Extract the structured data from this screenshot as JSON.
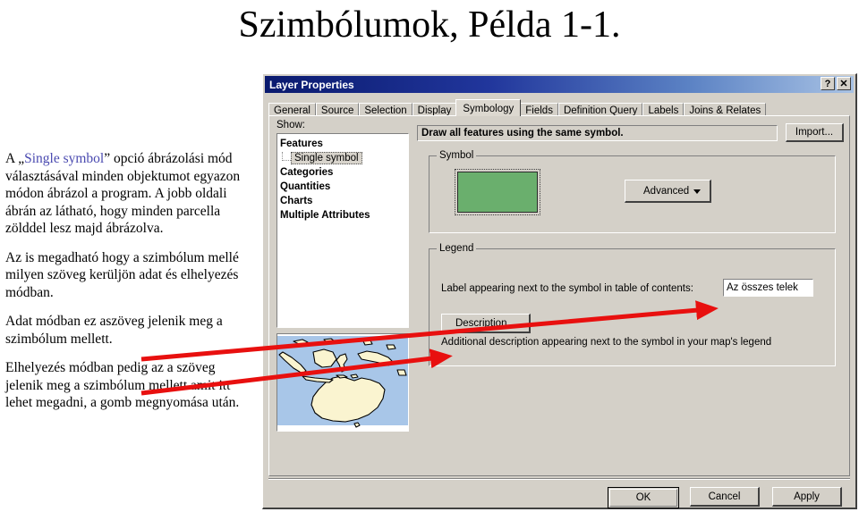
{
  "slide": {
    "title": "Szimbólumok, Példa 1-1.",
    "paragraphs": [
      {
        "before": "A „",
        "keyword": "Single symbol",
        "after": "” opció ábrázolási mód választásával minden objektumot egyazon módon ábrázol a program. A jobb oldali ábrán az látható, hogy minden parcella zölddel lesz majd ábrázolva."
      },
      {
        "text": "Az is megadható hogy a szimbólum mellé milyen szöveg kerüljön adat és elhelyezés módban."
      },
      {
        "text": "Adat módban ez aszöveg jelenik meg a szimbólum mellett."
      },
      {
        "text": "Elhelyezés módban pedig az a szöveg jelenik meg a szimbólum mellett amit itt lehet megadni, a gomb megnyomása után."
      }
    ],
    "annotation_arrow_color": "#e8100f"
  },
  "dialog": {
    "title": "Layer Properties",
    "help_button": "?",
    "close_button": "✕",
    "tabs": [
      {
        "label": "General",
        "active": false
      },
      {
        "label": "Source",
        "active": false
      },
      {
        "label": "Selection",
        "active": false
      },
      {
        "label": "Display",
        "active": false
      },
      {
        "label": "Symbology",
        "active": true
      },
      {
        "label": "Fields",
        "active": false
      },
      {
        "label": "Definition Query",
        "active": false
      },
      {
        "label": "Labels",
        "active": false
      },
      {
        "label": "Joins & Relates",
        "active": false
      }
    ],
    "symbology": {
      "show_label": "Show:",
      "tree": [
        {
          "label": "Features",
          "type": "node",
          "selected": false
        },
        {
          "label": "Single symbol",
          "type": "child",
          "selected": true
        },
        {
          "label": "Categories",
          "type": "node",
          "selected": false
        },
        {
          "label": "Quantities",
          "type": "node",
          "selected": false
        },
        {
          "label": "Charts",
          "type": "node",
          "selected": false
        },
        {
          "label": "Multiple Attributes",
          "type": "node",
          "selected": false
        }
      ],
      "description_banner": "Draw all features using the same symbol.",
      "import_button": "Import...",
      "symbol_group": {
        "title": "Symbol",
        "swatch_color": "#6aaf6d",
        "advanced_button": "Advanced"
      },
      "legend_group": {
        "title": "Legend",
        "label_text": "Label appearing next to the symbol in table of contents:",
        "label_value": "Az összes telek",
        "description_button": "Description...",
        "description_note": "Additional description appearing next to the symbol in your map's legend"
      },
      "map_preview": {
        "water_color": "#a8c6e8",
        "land_color": "#faf4d0"
      }
    },
    "buttons": {
      "ok": "OK",
      "cancel": "Cancel",
      "apply": "Apply"
    }
  }
}
